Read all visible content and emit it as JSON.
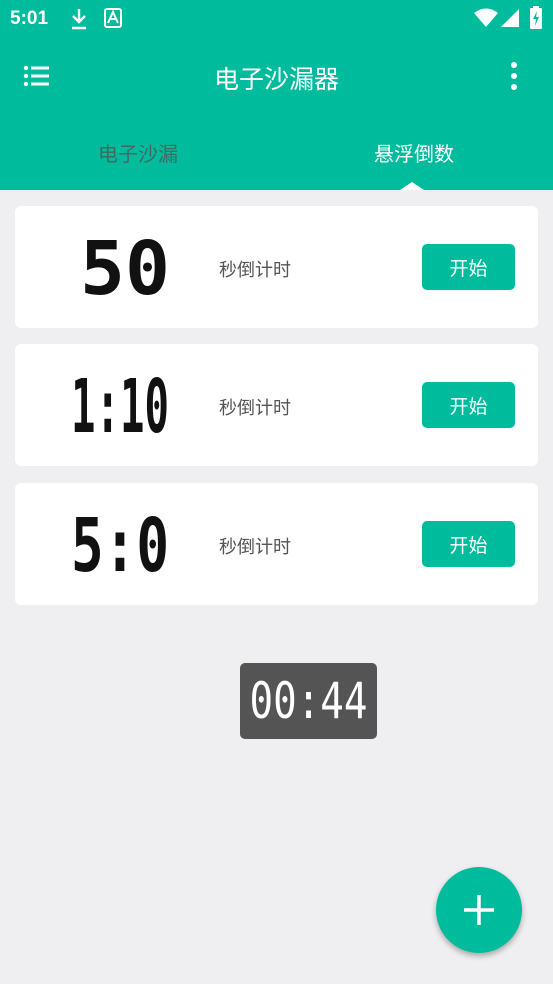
{
  "status_bar": {
    "time": "5:01",
    "icons": [
      "download-icon",
      "a-icon",
      "wifi-icon",
      "signal-icon",
      "battery-charging-icon"
    ]
  },
  "app_bar": {
    "title": "电子沙漏器",
    "menu_icon": "list-menu-icon",
    "more_icon": "more-vertical-icon"
  },
  "tabs": [
    {
      "label": "电子沙漏",
      "selected": false
    },
    {
      "label": "悬浮倒数",
      "selected": true
    }
  ],
  "timers": [
    {
      "time": "50",
      "label": "秒倒计时",
      "button": "开始"
    },
    {
      "time": "1:10",
      "label": "秒倒计时",
      "button": "开始"
    },
    {
      "time": "5:0",
      "label": "秒倒计时",
      "button": "开始"
    }
  ],
  "floating_timer": {
    "time": "00:44"
  },
  "fab": {
    "icon": "plus-icon"
  },
  "colors": {
    "primary": "#00bc9c",
    "background": "#efeff2",
    "float_bg": "#545454"
  }
}
